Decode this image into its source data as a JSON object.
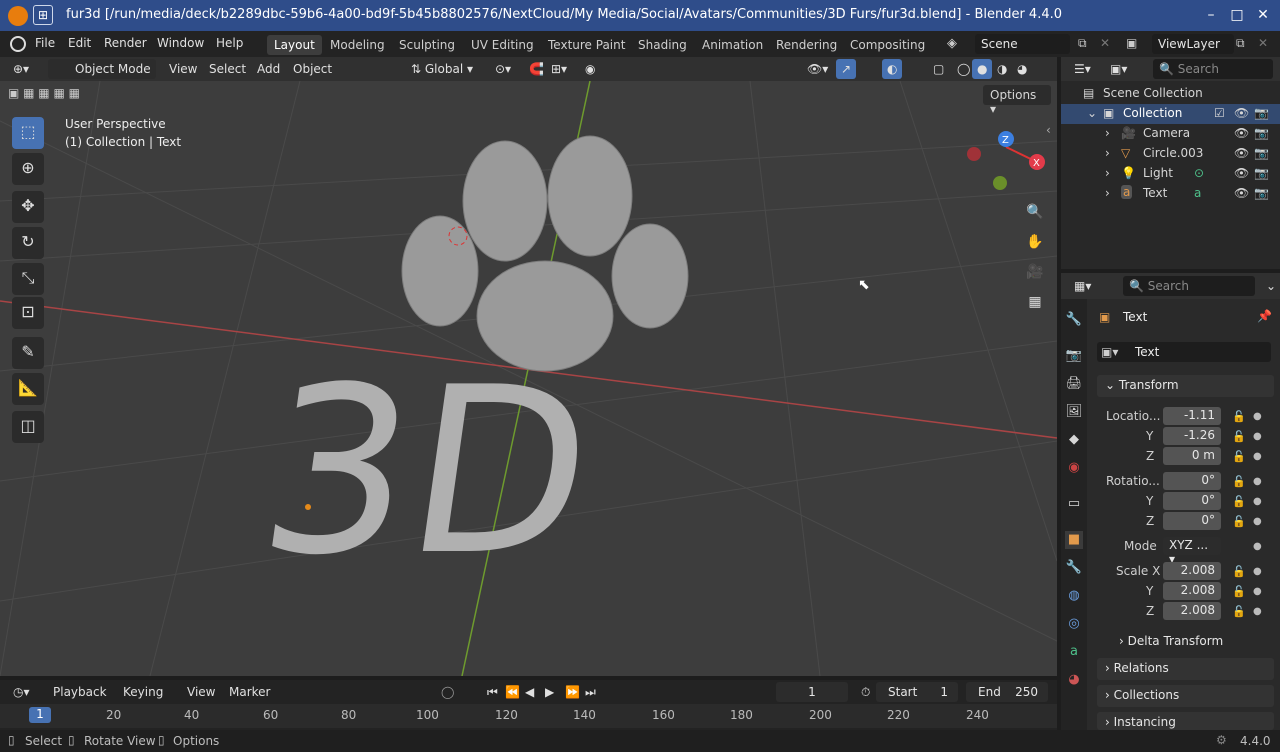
{
  "window": {
    "title": "fur3d [/run/media/deck/b2289dbc-59b6-4a00-bd9f-5b45b8802576/NextCloud/My Media/Social/Avatars/Communities/3D Furs/fur3d.blend] - Blender 4.4.0",
    "minimize": "–",
    "maximize": "□",
    "close": "✕"
  },
  "menu": [
    "File",
    "Edit",
    "Render",
    "Window",
    "Help"
  ],
  "workspaces": [
    "Layout",
    "Modeling",
    "Sculpting",
    "UV Editing",
    "Texture Paint",
    "Shading",
    "Animation",
    "Rendering",
    "Compositing"
  ],
  "scene": "Scene",
  "viewlayer": "ViewLayer",
  "viewport_header": {
    "mode": "Object Mode",
    "menus": [
      "View",
      "Select",
      "Add",
      "Object"
    ],
    "orientation": "Global",
    "options": "Options"
  },
  "viewport": {
    "perspective": "User Perspective",
    "collection": "(1) Collection | Text",
    "text3d": "3D",
    "gizmo": {
      "z": "Z",
      "x": "X"
    }
  },
  "outliner": {
    "search": "Search",
    "root": "Scene Collection",
    "collection": "Collection",
    "items": [
      "Camera",
      "Circle.003",
      "Light",
      "Text"
    ]
  },
  "properties": {
    "search": "Search",
    "object_name": "Text",
    "data_name": "Text",
    "transform_label": "Transform",
    "location_label": "Locatio...",
    "location": [
      "-1.11",
      "-1.26",
      "0 m"
    ],
    "rotation_label": "Rotatio...",
    "rotation": [
      "0°",
      "0°",
      "0°"
    ],
    "mode_label": "Mode",
    "mode": "XYZ ...",
    "scale_label": "Scale X",
    "scale": [
      "2.008",
      "2.008",
      "2.008"
    ],
    "axis_y": "Y",
    "axis_z": "Z",
    "delta": "Delta Transform",
    "panels": [
      "Relations",
      "Collections",
      "Instancing"
    ]
  },
  "timeline": {
    "menus": [
      "Playback",
      "Keying",
      "View",
      "Marker"
    ],
    "current": "1",
    "start_label": "Start",
    "start": "1",
    "end_label": "End",
    "end": "250",
    "ticks": [
      "20",
      "40",
      "60",
      "80",
      "100",
      "120",
      "140",
      "160",
      "180",
      "200",
      "220",
      "240"
    ],
    "frame": "1"
  },
  "status": {
    "select": "Select",
    "rotate": "Rotate View",
    "options": "Options",
    "version": "4.4.0"
  }
}
